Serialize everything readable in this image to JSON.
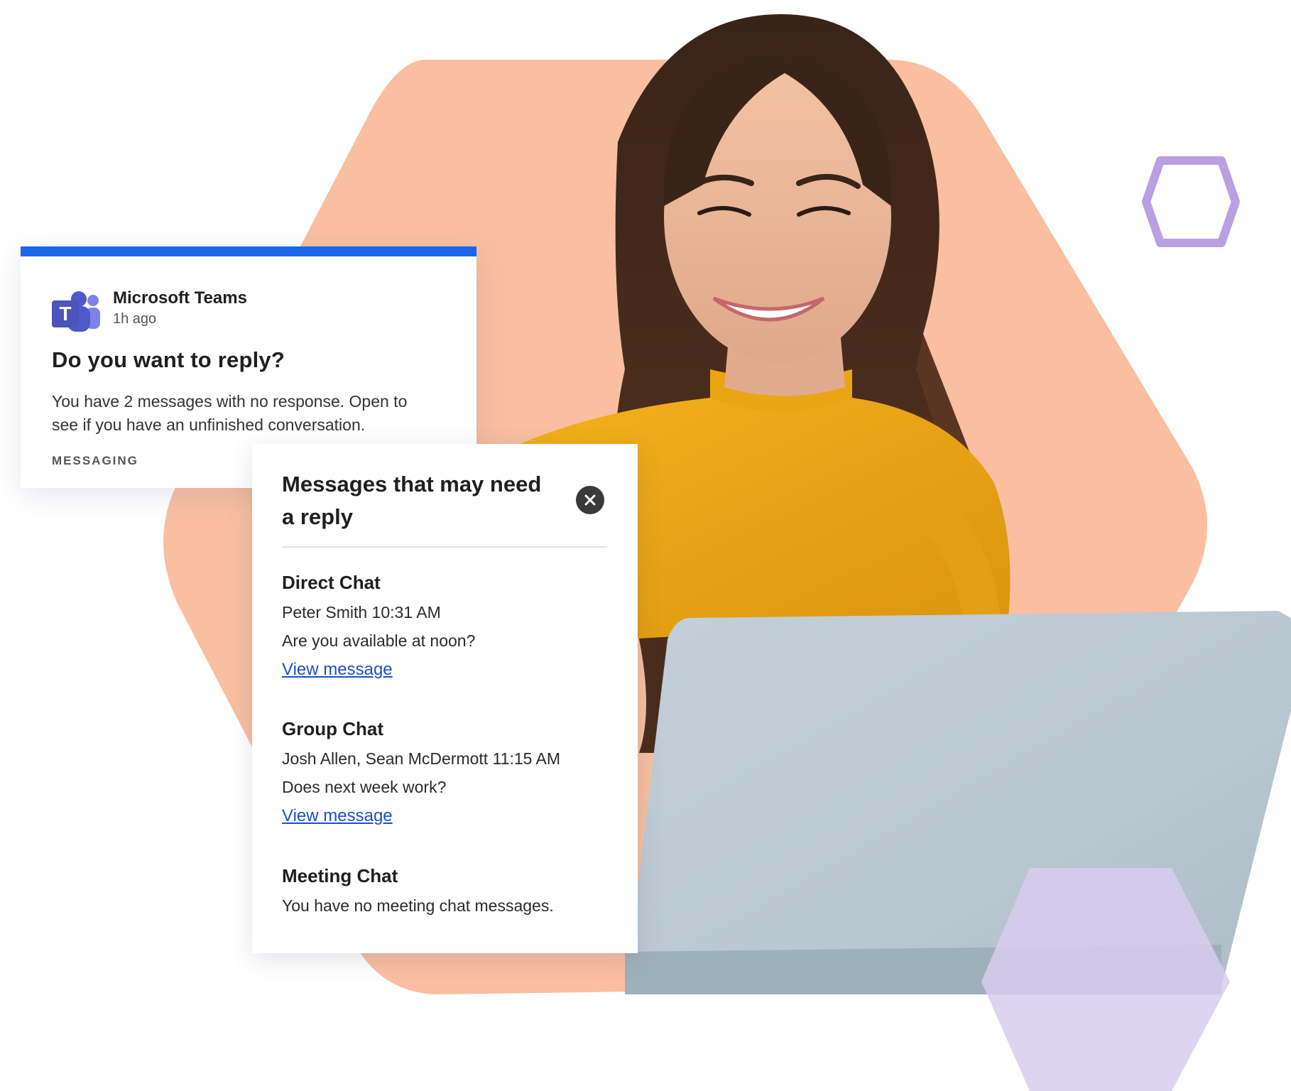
{
  "notification": {
    "app_name": "Microsoft Teams",
    "time": "1h ago",
    "title": "Do you want to reply?",
    "body": "You have 2 messages with no response. Open to see if you have an unfinished conversation.",
    "category": "MESSAGING",
    "accent_color": "#1a66e8"
  },
  "panel": {
    "title": "Messages that may need a reply",
    "close_icon": "close-icon",
    "sections": [
      {
        "heading": "Direct Chat",
        "meta": "Peter Smith 10:31 AM",
        "message": "Are you available at noon?",
        "link": "View message"
      },
      {
        "heading": "Group Chat",
        "meta": "Josh Allen, Sean McDermott 11:15 AM",
        "message": "Does next week work?",
        "link": "View message"
      },
      {
        "heading": "Meeting Chat",
        "message": "You have no meeting chat messages."
      }
    ]
  },
  "colors": {
    "hexagon_background": "#f9bfa0",
    "hexagon_outline": "#b9a0e0",
    "hexagon_lavender": "#d7cdee",
    "link": "#1a4fc8"
  }
}
